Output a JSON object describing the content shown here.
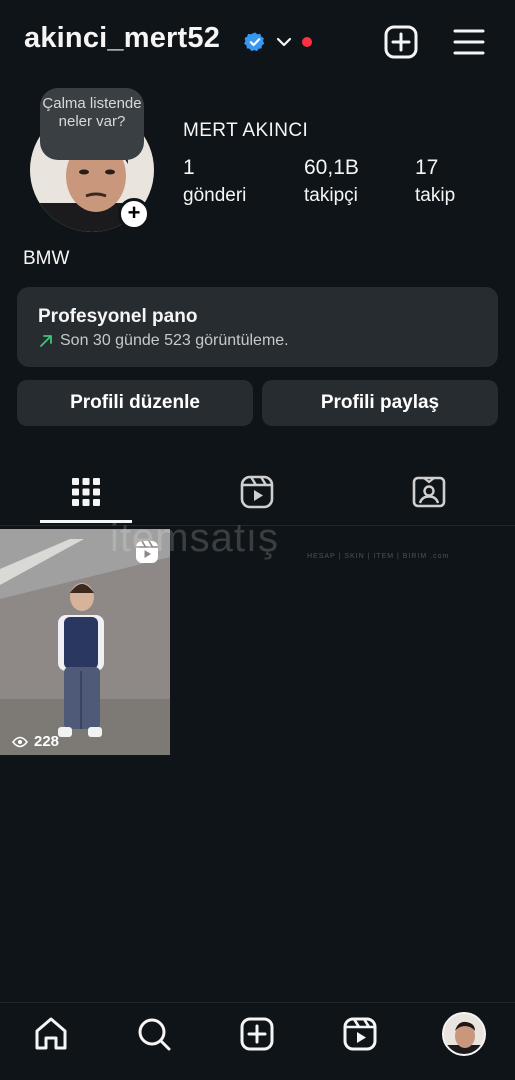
{
  "header": {
    "username": "akinci_mert52",
    "has_verified_badge": true,
    "notification_dot_color": "#ff3040"
  },
  "profile": {
    "note_bubble": "Çalma listende neler var?",
    "full_name": "MERT AKINCI",
    "stats": [
      {
        "value": "1",
        "label": "gönderi"
      },
      {
        "value": "60,1B",
        "label": "takipçi"
      },
      {
        "value": "17",
        "label": "takip"
      }
    ],
    "bio": "BMW"
  },
  "dashboard": {
    "title": "Profesyonel pano",
    "subtitle": "Son 30 günde 523 görüntüleme."
  },
  "buttons": {
    "edit": "Profili düzenle",
    "share": "Profili paylaş"
  },
  "tabs": [
    {
      "icon": "grid-icon",
      "active": true
    },
    {
      "icon": "reels-icon",
      "active": false
    },
    {
      "icon": "tagged-icon",
      "active": false
    }
  ],
  "posts": [
    {
      "type": "reel",
      "views": "228"
    }
  ],
  "watermark": {
    "text": "itemsatış",
    "sub": "HESAP | SKIN | ITEM | BIRIM .com"
  },
  "bottom_nav": [
    "home-icon",
    "search-icon",
    "create-icon",
    "reels-icon",
    "profile-avatar"
  ],
  "colors": {
    "background": "#0f1418",
    "surface": "#272c31",
    "verified": "#3897f0",
    "trend_arrow": "#3fc57a"
  }
}
